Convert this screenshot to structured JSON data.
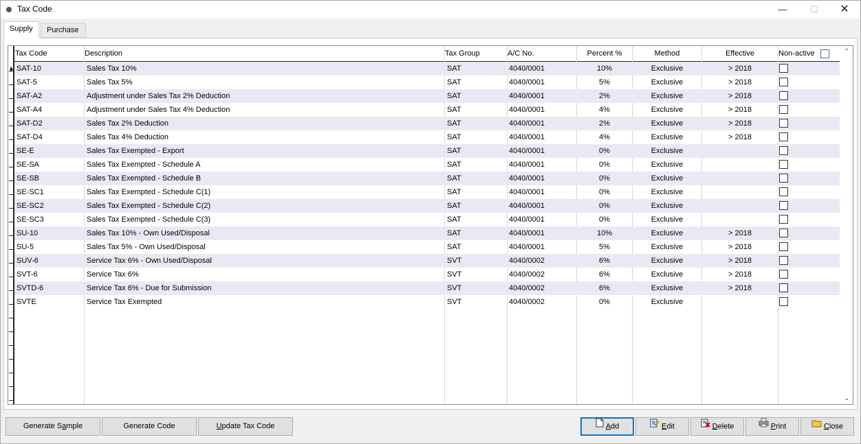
{
  "window": {
    "title": "Tax Code",
    "minimize_icon": "minimize-icon",
    "maximize_icon": "maximize-icon",
    "close_icon": "close-icon"
  },
  "tabs": [
    {
      "label": "Supply",
      "active": true
    },
    {
      "label": "Purchase",
      "active": false
    }
  ],
  "grid": {
    "columns": {
      "tax_code": "Tax Code",
      "description": "Description",
      "tax_group": "Tax Group",
      "ac_no": "A/C No.",
      "percent": "Percent %",
      "method": "Method",
      "effective": "Effective",
      "non_active": "Non-active"
    },
    "rows": [
      {
        "code": "SAT-10",
        "desc": "Sales Tax 10%",
        "group": "SAT",
        "ac": "4040/0001",
        "pct": "10%",
        "method": "Exclusive",
        "eff": "> 2018",
        "non_active": false
      },
      {
        "code": "SAT-5",
        "desc": "Sales Tax 5%",
        "group": "SAT",
        "ac": "4040/0001",
        "pct": "5%",
        "method": "Exclusive",
        "eff": "> 2018",
        "non_active": false
      },
      {
        "code": "SAT-A2",
        "desc": "Adjustment under Sales Tax 2% Deduction",
        "group": "SAT",
        "ac": "4040/0001",
        "pct": "2%",
        "method": "Exclusive",
        "eff": "> 2018",
        "non_active": false
      },
      {
        "code": "SAT-A4",
        "desc": "Adjustment under Sales Tax 4% Deduction",
        "group": "SAT",
        "ac": "4040/0001",
        "pct": "4%",
        "method": "Exclusive",
        "eff": "> 2018",
        "non_active": false
      },
      {
        "code": "SAT-D2",
        "desc": "Sales Tax 2% Deduction",
        "group": "SAT",
        "ac": "4040/0001",
        "pct": "2%",
        "method": "Exclusive",
        "eff": "> 2018",
        "non_active": false
      },
      {
        "code": "SAT-D4",
        "desc": "Sales Tax 4% Deduction",
        "group": "SAT",
        "ac": "4040/0001",
        "pct": "4%",
        "method": "Exclusive",
        "eff": "> 2018",
        "non_active": false
      },
      {
        "code": "SE-E",
        "desc": "Sales Tax Exempted - Export",
        "group": "SAT",
        "ac": "4040/0001",
        "pct": "0%",
        "method": "Exclusive",
        "eff": "",
        "non_active": false
      },
      {
        "code": "SE-SA",
        "desc": "Sales Tax Exempted - Schedule A",
        "group": "SAT",
        "ac": "4040/0001",
        "pct": "0%",
        "method": "Exclusive",
        "eff": "",
        "non_active": false
      },
      {
        "code": "SE-SB",
        "desc": "Sales Tax Exempted - Schedule B",
        "group": "SAT",
        "ac": "4040/0001",
        "pct": "0%",
        "method": "Exclusive",
        "eff": "",
        "non_active": false
      },
      {
        "code": "SE-SC1",
        "desc": "Sales Tax Exempted - Schedule C(1)",
        "group": "SAT",
        "ac": "4040/0001",
        "pct": "0%",
        "method": "Exclusive",
        "eff": "",
        "non_active": false
      },
      {
        "code": "SE-SC2",
        "desc": "Sales Tax Exempted - Schedule C(2)",
        "group": "SAT",
        "ac": "4040/0001",
        "pct": "0%",
        "method": "Exclusive",
        "eff": "",
        "non_active": false
      },
      {
        "code": "SE-SC3",
        "desc": "Sales Tax Exempted - Schedule C(3)",
        "group": "SAT",
        "ac": "4040/0001",
        "pct": "0%",
        "method": "Exclusive",
        "eff": "",
        "non_active": false
      },
      {
        "code": "SU-10",
        "desc": "Sales Tax 10% - Own Used/Disposal",
        "group": "SAT",
        "ac": "4040/0001",
        "pct": "10%",
        "method": "Exclusive",
        "eff": "> 2018",
        "non_active": false
      },
      {
        "code": "SU-5",
        "desc": "Sales Tax 5% - Own Used/Disposal",
        "group": "SAT",
        "ac": "4040/0001",
        "pct": "5%",
        "method": "Exclusive",
        "eff": "> 2018",
        "non_active": false
      },
      {
        "code": "SUV-6",
        "desc": "Service Tax 6% - Own Used/Disposal",
        "group": "SVT",
        "ac": "4040/0002",
        "pct": "6%",
        "method": "Exclusive",
        "eff": "> 2018",
        "non_active": false
      },
      {
        "code": "SVT-6",
        "desc": "Service Tax 6%",
        "group": "SVT",
        "ac": "4040/0002",
        "pct": "6%",
        "method": "Exclusive",
        "eff": "> 2018",
        "non_active": false
      },
      {
        "code": "SVTD-6",
        "desc": "Service Tax 6% - Due for Submission",
        "group": "SVT",
        "ac": "4040/0002",
        "pct": "6%",
        "method": "Exclusive",
        "eff": "> 2018",
        "non_active": false
      },
      {
        "code": "SVTE",
        "desc": "Service Tax Exempted",
        "group": "SVT",
        "ac": "4040/0002",
        "pct": "0%",
        "method": "Exclusive",
        "eff": "",
        "non_active": false
      }
    ],
    "empty_indicator_rows": 7
  },
  "buttons": {
    "generate_sample": {
      "pre": "Generate S",
      "u": "a",
      "post": "mple"
    },
    "generate_code": {
      "pre": "Generate Code",
      "u": "",
      "post": ""
    },
    "update_tax_code": {
      "pre": "",
      "u": "U",
      "post": "pdate Tax Code"
    },
    "add": {
      "pre": "",
      "u": "A",
      "post": "dd",
      "icon": "new-document-icon"
    },
    "edit": {
      "pre": "",
      "u": "E",
      "post": "dit",
      "icon": "edit-icon"
    },
    "delete": {
      "pre": "",
      "u": "D",
      "post": "elete",
      "icon": "delete-icon"
    },
    "print": {
      "pre": "",
      "u": "P",
      "post": "rint",
      "icon": "printer-icon"
    },
    "close": {
      "pre": "",
      "u": "C",
      "post": "lose",
      "icon": "folder-close-icon"
    }
  }
}
